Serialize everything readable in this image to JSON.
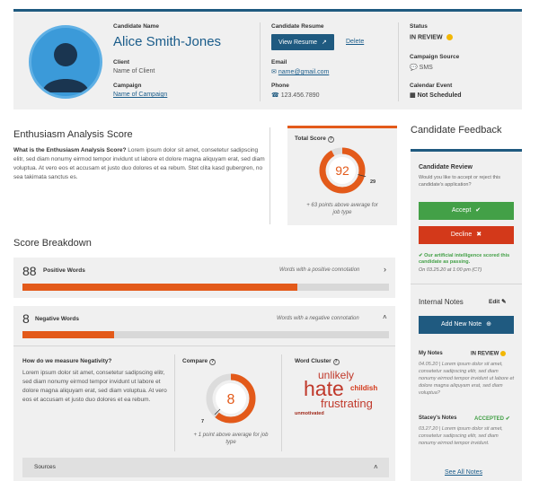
{
  "candidate": {
    "name_label": "Candidate Name",
    "name": "Alice Smith-Jones",
    "client_label": "Client",
    "client_value": "Name of Client",
    "campaign_label": "Campaign",
    "campaign_value": "Name of Campaign"
  },
  "resume": {
    "label": "Candidate Resume",
    "view_button": "View Resume",
    "delete_link": "Delete",
    "email_label": "Email",
    "email_value": "name@gmail.com",
    "phone_label": "Phone",
    "phone_value": "123.456.7890"
  },
  "status": {
    "label": "Status",
    "value": "IN REVIEW",
    "source_label": "Campaign Source",
    "source_value": "SMS",
    "calendar_label": "Calendar Event",
    "calendar_value": "Not Scheduled"
  },
  "enthusiasm": {
    "title": "Enthusiasm Analysis Score",
    "question": "What is the Enthusiasm Analysis Score?",
    "text": "Lorem ipsum dolor sit amet, consetetur sadipscing elitr, sed diam nonumy eirmod tempor invidunt ut labore et dolore magna aliquyam erat, sed diam voluptua. At vero eos et accusam et justo duo dolores et ea rebum. Stet clita kasd gubergren, no sea takimata sanctus es."
  },
  "total_score": {
    "label": "Total Score",
    "score": "92",
    "score_fraction": 0.92,
    "average": "29",
    "average_fraction": 0.29,
    "note": "+ 63 points above average for job type"
  },
  "breakdown": {
    "title": "Score Breakdown",
    "positive": {
      "count": "88",
      "label": "Positive Words",
      "hint": "Words with a positive connotation",
      "fill_fraction": 0.75
    },
    "negative": {
      "count": "8",
      "label": "Negative Words",
      "hint": "Words with a negative connotation",
      "fill_fraction": 0.25
    },
    "measure_title": "How do we measure Negativity?",
    "measure_text": "Lorem ipsum dolor sit amet, consetetur sadipscing elitr, sed diam nonumy eirmod tempor invidunt ut labore et dolore magna aliquyam erat, sed diam voluptua. At vero eos et accusam et justo duo dolores et ea rebum.",
    "compare_label": "Compare",
    "compare_score": "8",
    "compare_average": "7",
    "compare_note": "+ 1 point above average for job type",
    "cluster_label": "Word Cluster",
    "cluster_words": [
      "unlikely",
      "hate",
      "childish",
      "frustrating",
      "unmotivated"
    ],
    "sources_label": "Sources"
  },
  "feedback": {
    "title": "Candidate Feedback",
    "review_title": "Candidate Review",
    "review_question": "Would you like to accept or reject this candidate's application?",
    "accept": "Accept",
    "decline": "Decline",
    "ai_note": "Our artificial intelligence scored this candidate as passing.",
    "ai_date": "On 03.25.20 at 1:00 pm (CT)",
    "notes_title": "Internal Notes",
    "edit_label": "Edit",
    "add_note": "Add New Note",
    "my_notes_label": "My Notes",
    "my_notes_status": "IN REVIEW",
    "my_notes_text": "04.05.20 | Lorem ipsum dolor sit amet, consetetur sadipscing elitr, sed diam nonumy eirmod tempor invidunt ut labore et dolore magna aliquyam erat, sed diam voluptua?",
    "stacey_label": "Stacey's Notes",
    "stacey_status": "ACCEPTED",
    "stacey_text": "03.27.20 | Lorem ipsum dolor sit amet, consetetur sadipscing elitr, sed diam nonumy eirmod tempor invidunt.",
    "see_all": "See All Notes"
  },
  "colors": {
    "brand": "#1f5a80",
    "accent": "#e35a1a",
    "success": "#43a047",
    "danger": "#d3391a",
    "warning": "#f2b705"
  }
}
